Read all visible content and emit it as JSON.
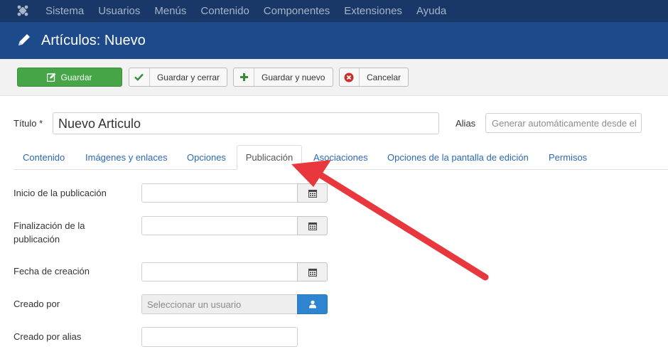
{
  "topmenu": {
    "items": [
      "Sistema",
      "Usuarios",
      "Menús",
      "Contenido",
      "Componentes",
      "Extensiones",
      "Ayuda"
    ]
  },
  "header": {
    "title": "Artículos: Nuevo"
  },
  "toolbar": {
    "save": "Guardar",
    "save_close": "Guardar y cerrar",
    "save_new": "Guardar y nuevo",
    "cancel": "Cancelar"
  },
  "form": {
    "title_label": "Título *",
    "title_value": "Nuevo Articulo",
    "alias_label": "Alias",
    "alias_placeholder": "Generar automáticamente desde el"
  },
  "tabs": {
    "items": [
      "Contenido",
      "Imágenes y enlaces",
      "Opciones",
      "Publicación",
      "Asociaciones",
      "Opciones de la pantalla de edición",
      "Permisos"
    ],
    "active": "Publicación"
  },
  "fields": {
    "publish_up": "Inicio de la publicación",
    "publish_down_1": "Finalización de la",
    "publish_down_2": "publicación",
    "created": "Fecha de creación",
    "created_by": "Creado por",
    "created_by_placeholder": "Seleccionar un usuario",
    "created_by_alias": "Creado por alias"
  },
  "colors": {
    "topbar": "#1a3867",
    "header": "#1c4a8a",
    "save_button": "#46a546",
    "user_button": "#2f84d0",
    "arrow": "#e8383e"
  }
}
